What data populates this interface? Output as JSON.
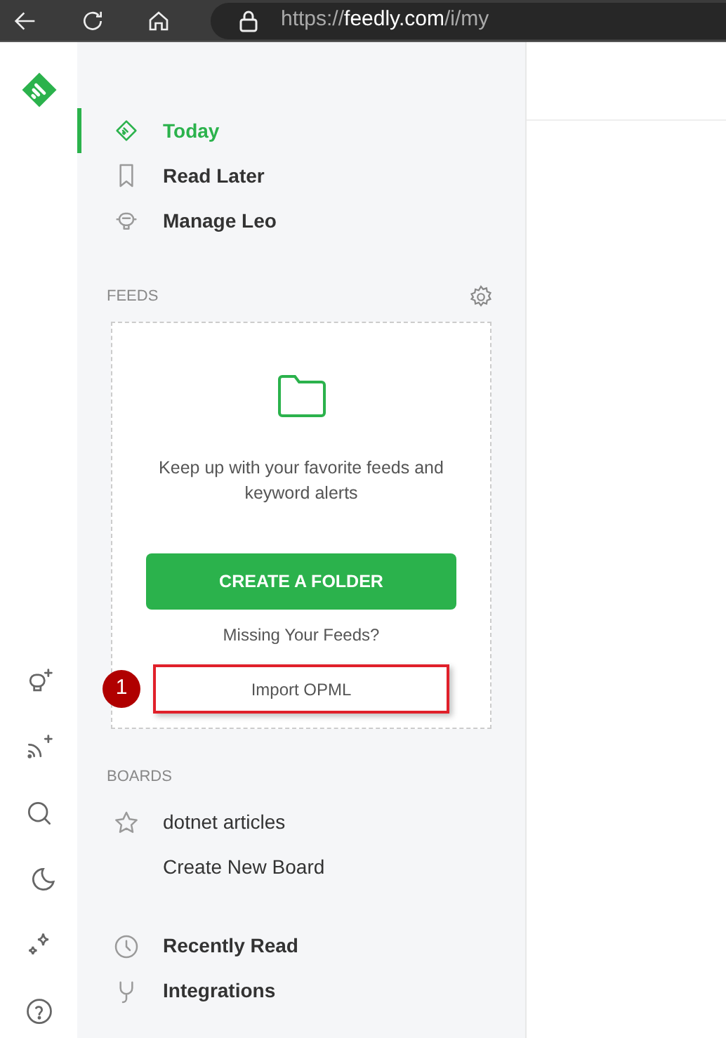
{
  "browser": {
    "url_scheme": "https://",
    "url_host": "feedly.com",
    "url_path": "/i/my"
  },
  "nav": [
    {
      "label": "Today",
      "selected": true
    },
    {
      "label": "Read Later",
      "selected": false
    },
    {
      "label": "Manage Leo",
      "selected": false
    }
  ],
  "feeds": {
    "heading": "FEEDS",
    "message": "Keep up with your favorite feeds and keyword alerts",
    "create_button": "CREATE A FOLDER",
    "missing": "Missing Your Feeds?",
    "import_link": "Import OPML",
    "callout": "1"
  },
  "boards": {
    "heading": "BOARDS",
    "items": [
      {
        "label": "dotnet articles"
      },
      {
        "label": "Create New Board"
      }
    ]
  },
  "footer_nav": [
    {
      "label": "Recently Read"
    },
    {
      "label": "Integrations"
    }
  ]
}
